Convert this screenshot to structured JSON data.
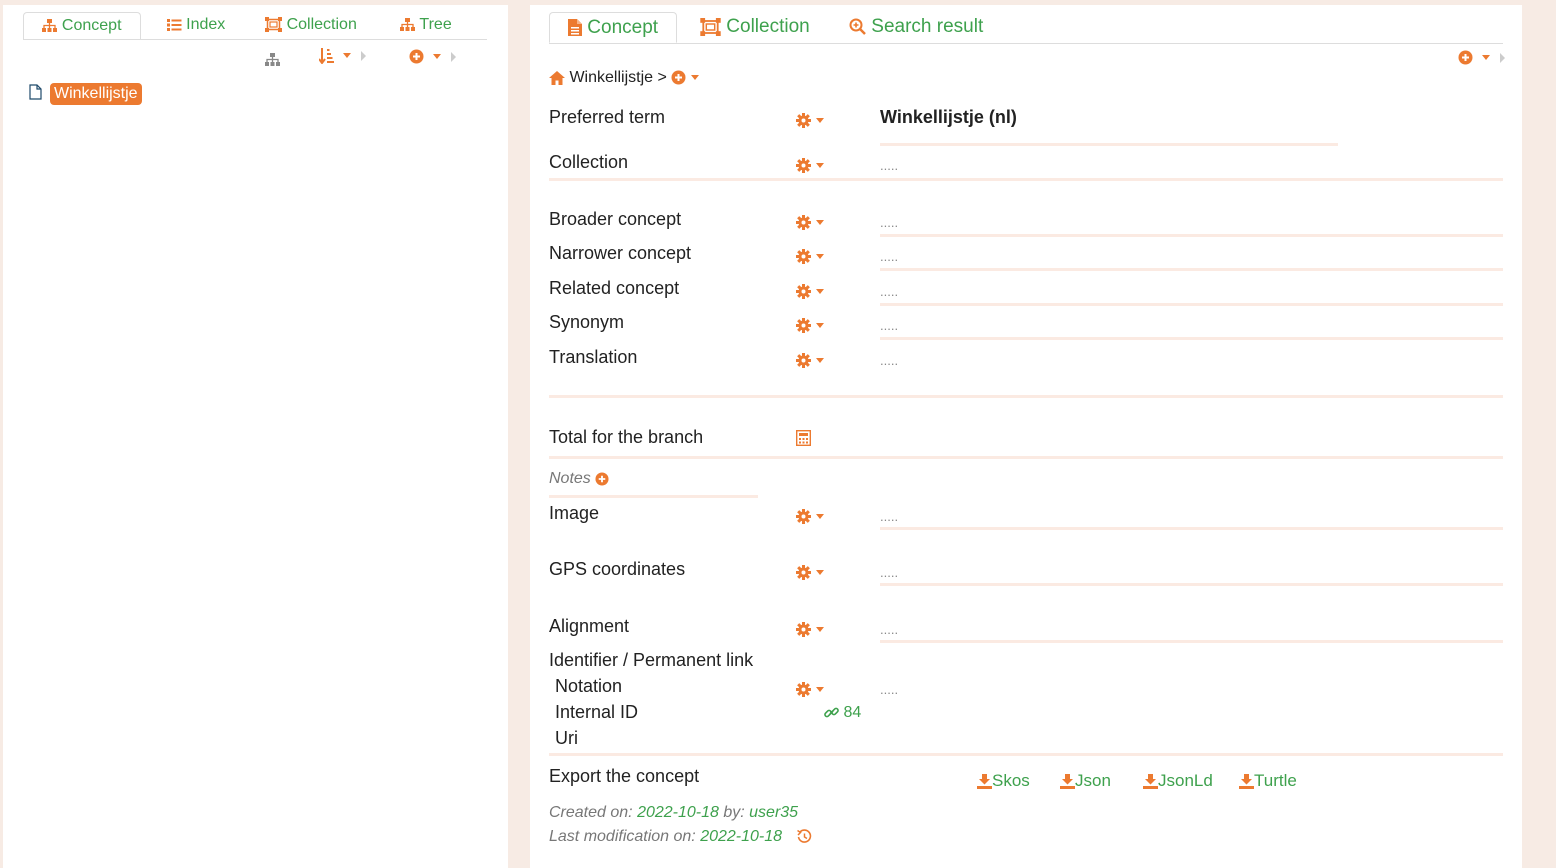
{
  "colors": {
    "accent": "#ec7a30",
    "link": "#3ea14d",
    "background": "#f7ebe4"
  },
  "left": {
    "tabs": [
      {
        "label": "Concept",
        "icon": "sitemap-icon"
      },
      {
        "label": "Index",
        "icon": "list-icon"
      },
      {
        "label": "Collection",
        "icon": "collection-icon"
      },
      {
        "label": "Tree",
        "icon": "sitemap-icon"
      }
    ],
    "tree": {
      "node_label": "Winkellijstje"
    }
  },
  "right": {
    "tabs": [
      {
        "label": "Concept",
        "icon": "document-icon"
      },
      {
        "label": "Collection",
        "icon": "collection-icon"
      },
      {
        "label": "Search result",
        "icon": "search-plus-icon"
      }
    ],
    "breadcrumb": {
      "label": "Winkellijstje",
      "separator": ">"
    },
    "fields": {
      "preferred_term": {
        "label": "Preferred term",
        "value": "Winkellijstje (nl)"
      },
      "collection": {
        "label": "Collection",
        "value": "....."
      },
      "broader": {
        "label": "Broader concept",
        "value": "....."
      },
      "narrower": {
        "label": "Narrower concept",
        "value": "....."
      },
      "related": {
        "label": "Related concept",
        "value": "....."
      },
      "synonym": {
        "label": "Synonym",
        "value": "....."
      },
      "translation": {
        "label": "Translation",
        "value": "....."
      },
      "total_branch": {
        "label": "Total for the branch"
      },
      "notes": {
        "label": "Notes"
      },
      "image": {
        "label": "Image",
        "value": "....."
      },
      "gps": {
        "label": "GPS coordinates",
        "value": "....."
      },
      "alignment": {
        "label": "Alignment",
        "value": "....."
      },
      "identifier": {
        "label": "Identifier / Permanent link"
      },
      "notation": {
        "label": "Notation",
        "value": "....."
      },
      "internal_id": {
        "label": "Internal ID",
        "value": "84"
      },
      "uri": {
        "label": "Uri"
      }
    },
    "export": {
      "label": "Export the concept",
      "formats": [
        "Skos",
        "Json",
        "JsonLd",
        "Turtle"
      ]
    },
    "meta": {
      "created_label": "Created on:",
      "created_date": "2022-10-18",
      "by_label": "by:",
      "user": "user35",
      "modified_label": "Last modification on:",
      "modified_date": "2022-10-18"
    }
  }
}
